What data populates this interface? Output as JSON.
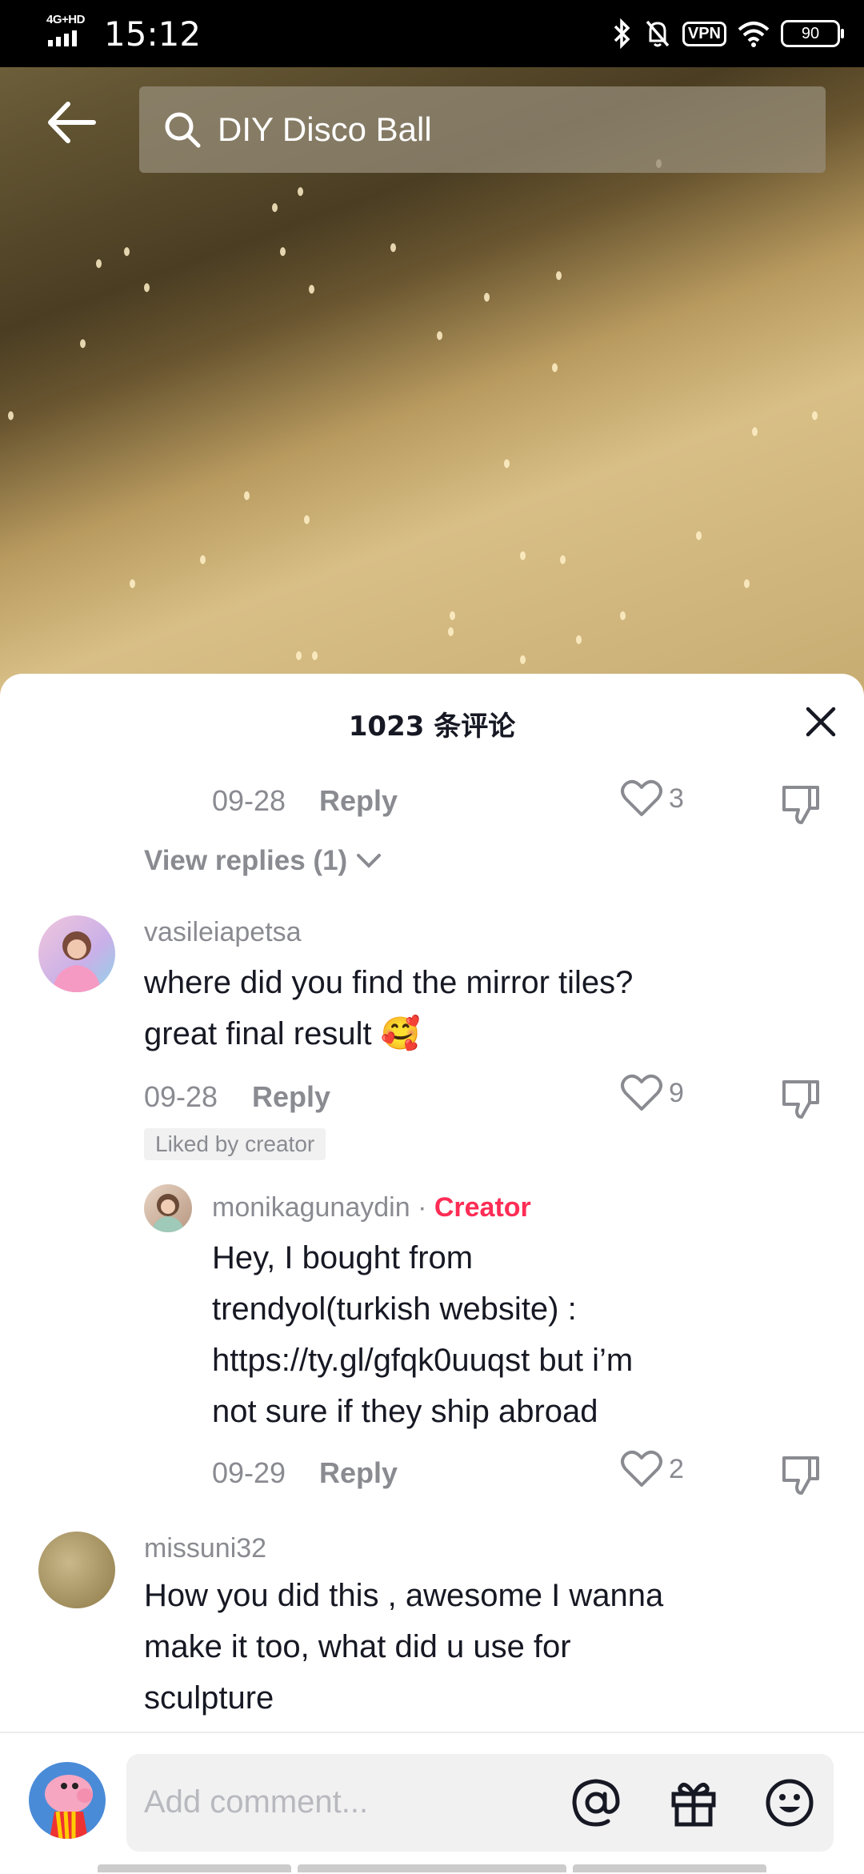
{
  "status": {
    "network_tag": "4G+HD",
    "time": "15:12",
    "vpn": "VPN",
    "battery": "90"
  },
  "search": {
    "query": "DIY Disco Ball"
  },
  "comments_sheet": {
    "title": "1023 条评论",
    "first_reply": {
      "date": "09-28",
      "reply_label": "Reply",
      "likes": "3"
    },
    "view_replies": "View replies (1)",
    "comments": [
      {
        "username": "vasileiapetsa",
        "text_line1": "where did you find the mirror tiles?",
        "text_line2": "great final result 🥰",
        "date": "09-28",
        "reply_label": "Reply",
        "likes": "9",
        "badge": "Liked by creator"
      },
      {
        "username": "monikagunaydin",
        "separator": "·",
        "creator_label": "Creator",
        "text_line1": "Hey, I bought from",
        "text_line2": "trendyol(turkish website) :",
        "text_line3": "https://ty.gl/gfqk0uuqst but i’m",
        "text_line4": "not sure if they ship abroad",
        "date": "09-29",
        "reply_label": "Reply",
        "likes": "2"
      },
      {
        "username": "missuni32",
        "text_line1": "How you did this , awesome I wanna",
        "text_line2": "make it too, what did u use for",
        "text_line3": "sculpture"
      }
    ]
  },
  "input": {
    "placeholder": "Add comment..."
  },
  "colors": {
    "accent": "#fe2c55",
    "text": "#161823",
    "muted": "#8a8b91"
  }
}
